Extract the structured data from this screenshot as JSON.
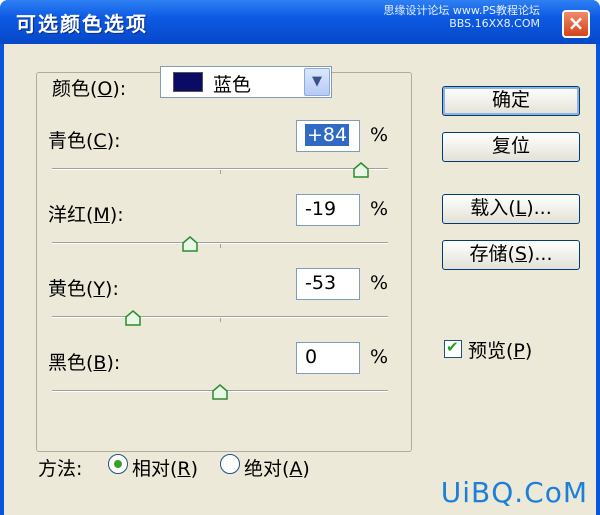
{
  "window": {
    "title": "可选颜色选项",
    "watermark_line1": "思缘设计论坛  www.PS教程论坛",
    "watermark_line2": "BBS.16XX8.COM",
    "close_glyph": "×"
  },
  "colors_group": {
    "label_prefix": "颜色(",
    "label_key": "O",
    "label_suffix": "):",
    "selected": "蓝色",
    "swatch_color": "#0b0b66",
    "arrow_glyph": "▼"
  },
  "sliders": [
    {
      "prefix": "青色(",
      "key": "C",
      "suffix": "):",
      "value": "+84",
      "percent": "%",
      "level": 0.92
    },
    {
      "prefix": "洋红(",
      "key": "M",
      "suffix": "):",
      "value": "-19",
      "percent": "%",
      "level": 0.41
    },
    {
      "prefix": "黄色(",
      "key": "Y",
      "suffix": "):",
      "value": "-53",
      "percent": "%",
      "level": 0.24
    },
    {
      "prefix": "黑色(",
      "key": "B",
      "suffix": "):",
      "value": "0",
      "percent": "%",
      "level": 0.5
    }
  ],
  "buttons": {
    "ok": "确定",
    "reset": "复位",
    "load_prefix": "载入(",
    "load_key": "L",
    "load_suffix": ")...",
    "save_prefix": "存储(",
    "save_key": "S",
    "save_suffix": ")..."
  },
  "preview": {
    "prefix": "预览(",
    "key": "P",
    "suffix": ")",
    "checked": true,
    "check_glyph": "✔"
  },
  "method": {
    "label": "方法:",
    "relative_prefix": "相对(",
    "relative_key": "R",
    "relative_suffix": ")",
    "absolute_prefix": "绝对(",
    "absolute_key": "A",
    "absolute_suffix": ")",
    "selected": "relative"
  },
  "brand": "UiBQ.CoM",
  "accent_color": "#36a126"
}
